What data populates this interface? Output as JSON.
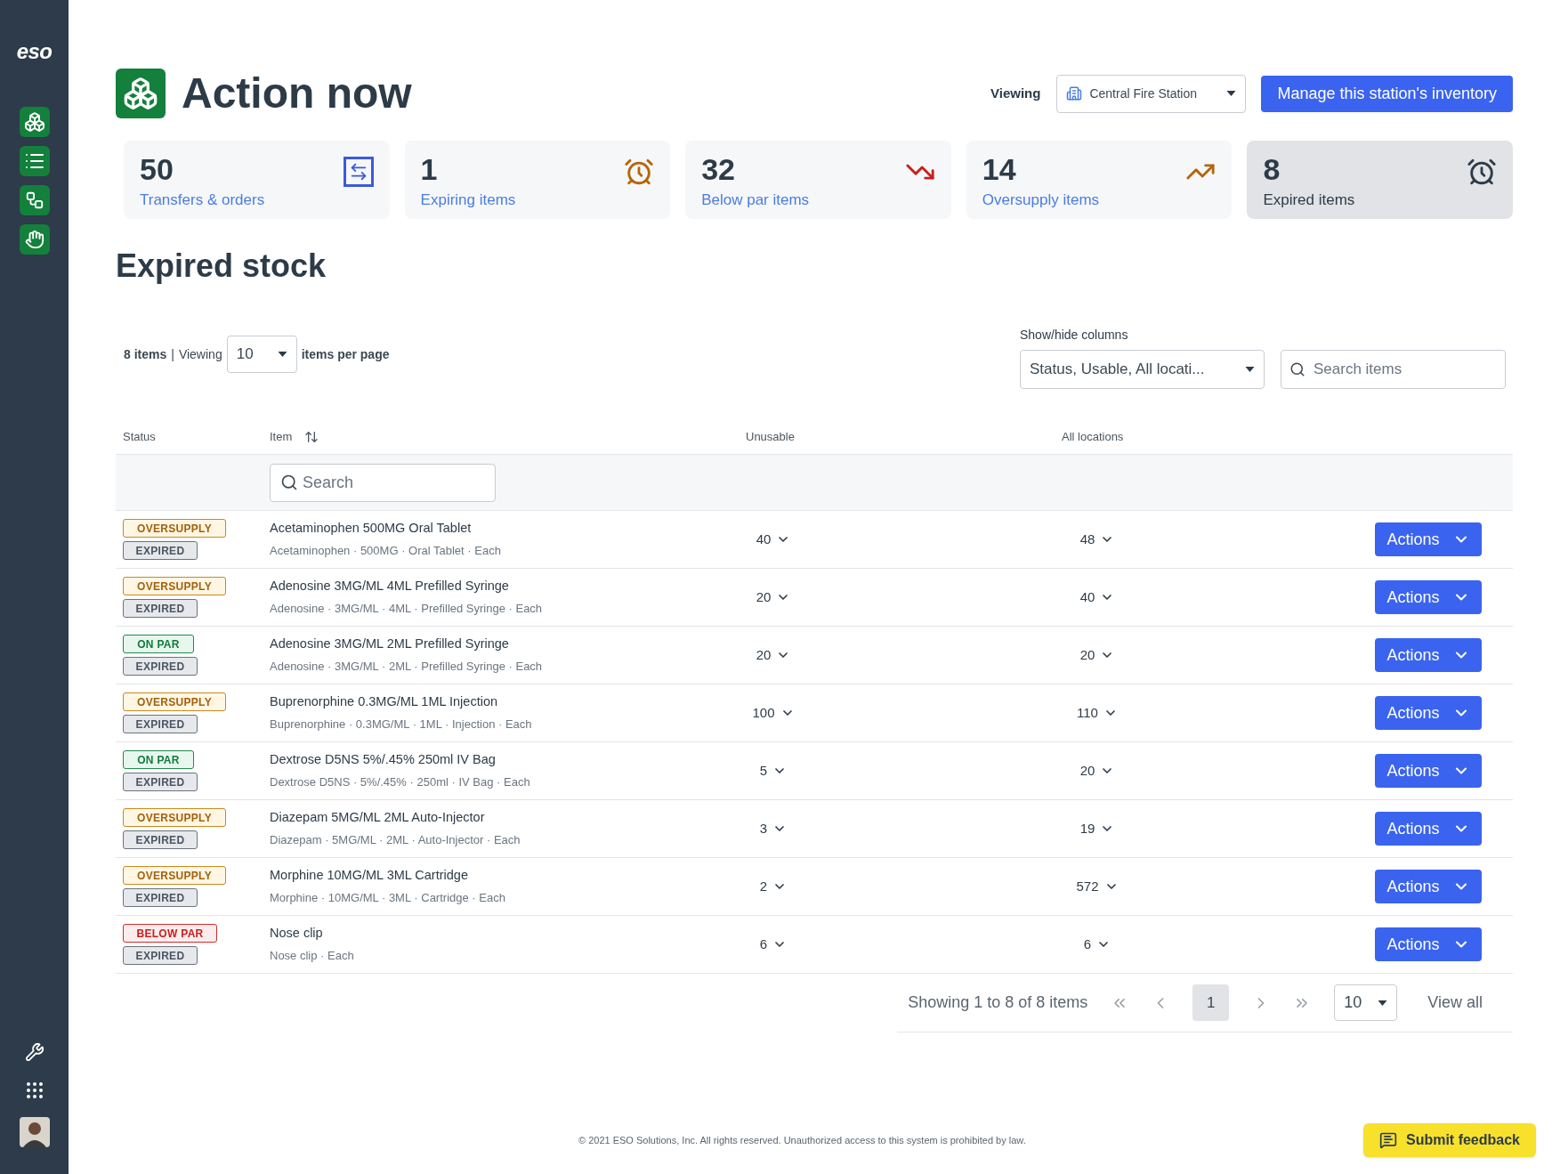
{
  "sidebar": {
    "logo": "eso"
  },
  "header": {
    "title": "Action now",
    "viewing_label": "Viewing",
    "station": "Central Fire Station",
    "manage_button": "Manage this station's inventory"
  },
  "cards": [
    {
      "count": "50",
      "label": "Transfers & orders",
      "kind": "transfers",
      "selected": false
    },
    {
      "count": "1",
      "label": "Expiring items",
      "kind": "expiring",
      "selected": false
    },
    {
      "count": "32",
      "label": "Below par items",
      "kind": "below_par",
      "selected": false
    },
    {
      "count": "14",
      "label": "Oversupply items",
      "kind": "oversupply",
      "selected": false
    },
    {
      "count": "8",
      "label": "Expired items",
      "kind": "expired",
      "selected": true
    }
  ],
  "section_title": "Expired stock",
  "list_controls": {
    "count": "8 items",
    "separator": "|",
    "viewing": "Viewing",
    "per_page": "10",
    "suffix": "items per page"
  },
  "columns_control": {
    "label": "Show/hide columns",
    "value": "Status, Usable, All locati..."
  },
  "search": {
    "placeholder": "Search items"
  },
  "table": {
    "columns": [
      "Status",
      "Item",
      "Unusable",
      "All locations"
    ],
    "filter_placeholder": "Search",
    "rows": [
      {
        "tags": [
          {
            "label": "OVERSUPPLY",
            "kind": "oversupply"
          },
          {
            "label": "EXPIRED",
            "kind": "expired"
          }
        ],
        "name": "Acetaminophen 500MG Oral Tablet",
        "details": "Acetaminophen · 500MG · Oral Tablet · Each",
        "unusable": "40",
        "all_locations": "48",
        "action": "Actions"
      },
      {
        "tags": [
          {
            "label": "OVERSUPPLY",
            "kind": "oversupply"
          },
          {
            "label": "EXPIRED",
            "kind": "expired"
          }
        ],
        "name": "Adenosine 3MG/ML 4ML Prefilled Syringe",
        "details": "Adenosine · 3MG/ML · 4ML · Prefilled Syringe · Each",
        "unusable": "20",
        "all_locations": "40",
        "action": "Actions"
      },
      {
        "tags": [
          {
            "label": "ON PAR",
            "kind": "on_par"
          },
          {
            "label": "EXPIRED",
            "kind": "expired"
          }
        ],
        "name": "Adenosine 3MG/ML 2ML Prefilled Syringe",
        "details": "Adenosine · 3MG/ML · 2ML · Prefilled Syringe · Each",
        "unusable": "20",
        "all_locations": "20",
        "action": "Actions"
      },
      {
        "tags": [
          {
            "label": "OVERSUPPLY",
            "kind": "oversupply"
          },
          {
            "label": "EXPIRED",
            "kind": "expired"
          }
        ],
        "name": "Buprenorphine 0.3MG/ML 1ML Injection",
        "details": "Buprenorphine · 0.3MG/ML · 1ML · Injection · Each",
        "unusable": "100",
        "all_locations": "110",
        "action": "Actions"
      },
      {
        "tags": [
          {
            "label": "ON PAR",
            "kind": "on_par"
          },
          {
            "label": "EXPIRED",
            "kind": "expired"
          }
        ],
        "name": "Dextrose D5NS 5%/.45% 250ml IV Bag",
        "details": "Dextrose D5NS · 5%/.45% · 250ml · IV Bag · Each",
        "unusable": "5",
        "all_locations": "20",
        "action": "Actions"
      },
      {
        "tags": [
          {
            "label": "OVERSUPPLY",
            "kind": "oversupply"
          },
          {
            "label": "EXPIRED",
            "kind": "expired"
          }
        ],
        "name": "Diazepam 5MG/ML 2ML Auto-Injector",
        "details": "Diazepam · 5MG/ML · 2ML · Auto-Injector · Each",
        "unusable": "3",
        "all_locations": "19",
        "action": "Actions"
      },
      {
        "tags": [
          {
            "label": "OVERSUPPLY",
            "kind": "oversupply"
          },
          {
            "label": "EXPIRED",
            "kind": "expired"
          }
        ],
        "name": "Morphine 10MG/ML 3ML Cartridge",
        "details": "Morphine · 10MG/ML · 3ML · Cartridge · Each",
        "unusable": "2",
        "all_locations": "572",
        "action": "Actions"
      },
      {
        "tags": [
          {
            "label": "BELOW PAR",
            "kind": "below_par"
          },
          {
            "label": "EXPIRED",
            "kind": "expired"
          }
        ],
        "name": "Nose clip",
        "details": "Nose clip · Each",
        "unusable": "6",
        "all_locations": "6",
        "action": "Actions"
      }
    ]
  },
  "pagination": {
    "summary": "Showing 1 to 8 of 8 items",
    "pages": [
      {
        "label": "1",
        "selected": true
      }
    ],
    "per_page": "10",
    "view_all": "View all"
  },
  "footer": "© 2021 ESO Solutions, Inc. All rights reserved. Unauthorized access to this system is prohibited by law.",
  "feedback_button": "Submit feedback"
}
